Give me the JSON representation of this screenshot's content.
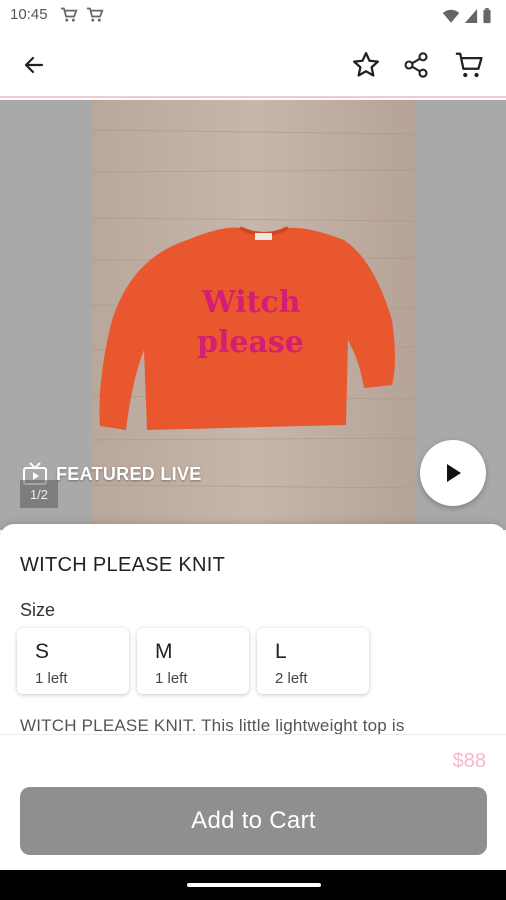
{
  "status_bar": {
    "time": "10:45",
    "left_icons": [
      "cart-notification-icon",
      "cart-notification-icon"
    ],
    "right_icons": [
      "wifi-icon",
      "signal-icon",
      "battery-icon"
    ]
  },
  "app_bar": {
    "icons": [
      "back-arrow-icon",
      "star-icon",
      "share-icon",
      "cart-icon"
    ],
    "accent_line_color": "#f4c7d6"
  },
  "media": {
    "featured_label": "FEATURED LIVE",
    "counter": "1/2",
    "photo_text": [
      "Witch",
      "please"
    ]
  },
  "product": {
    "title": "WITCH PLEASE KNIT",
    "size_label": "Size",
    "sizes": [
      {
        "name": "S",
        "stock": "1 left"
      },
      {
        "name": "M",
        "stock": "1 left"
      },
      {
        "name": "L",
        "stock": "2 left"
      }
    ],
    "description": "WITCH PLEASE KNIT. This little lightweight top is",
    "price": "$88",
    "add_to_cart": "Add to Cart"
  },
  "colors": {
    "price": "#f6b8cc",
    "button": "#8f8f8f",
    "sweater": "#e8572e",
    "sweater_text": "#d41e74"
  }
}
